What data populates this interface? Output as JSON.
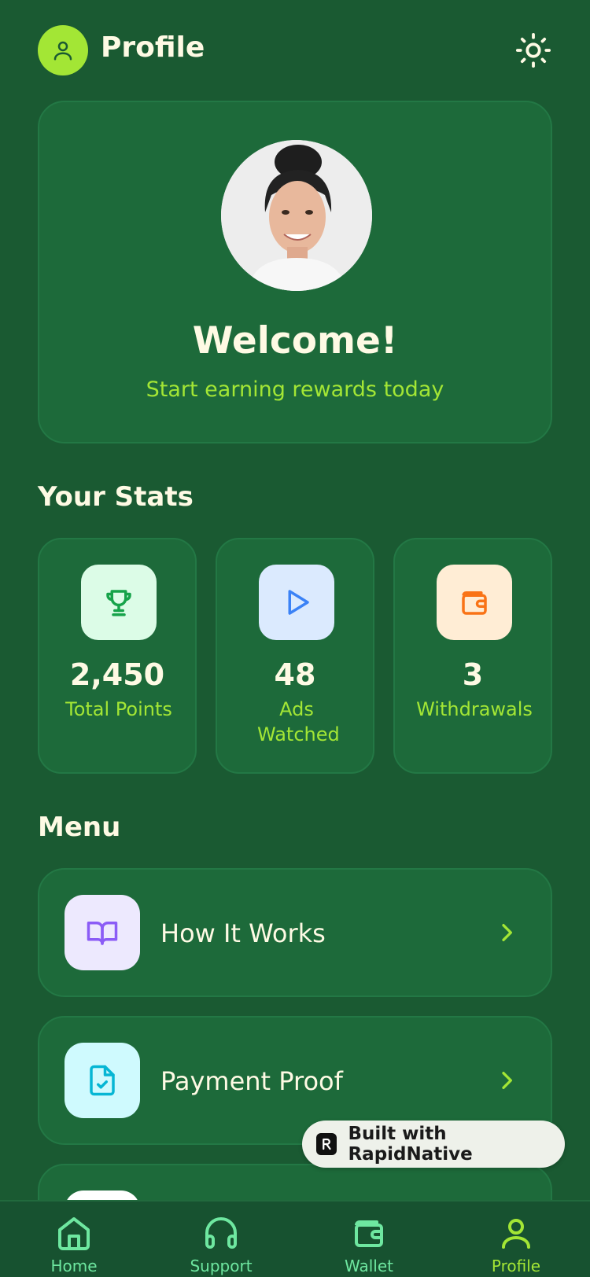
{
  "header": {
    "title": "Profile",
    "avatar_icon": "user-icon",
    "theme_icon": "sun-icon"
  },
  "profile": {
    "welcome": "Welcome!",
    "subtitle": "Start earning rewards today"
  },
  "stats": {
    "title": "Your Stats",
    "items": [
      {
        "icon": "trophy-icon",
        "value": "2,450",
        "label": "Total Points",
        "bg": "#dcfce7",
        "color": "#16a34a"
      },
      {
        "icon": "play-icon",
        "value": "48",
        "label": "Ads Watched",
        "bg": "#dbeafe",
        "color": "#3b82f6"
      },
      {
        "icon": "wallet-icon",
        "value": "3",
        "label": "Withdrawals",
        "bg": "#ffedd5",
        "color": "#f97316"
      }
    ]
  },
  "menu": {
    "title": "Menu",
    "items": [
      {
        "icon": "book-open-icon",
        "label": "How It Works",
        "bg": "#ede9fe",
        "color": "#8b5cf6"
      },
      {
        "icon": "file-check-icon",
        "label": "Payment Proof",
        "bg": "#cffafe",
        "color": "#06b6d4"
      },
      {
        "icon": "more-icon",
        "label": "",
        "bg": "#ffffff",
        "color": "#ffffff"
      }
    ]
  },
  "badge": {
    "text": "Built with RapidNative"
  },
  "nav": {
    "items": [
      {
        "icon": "home-icon",
        "label": "Home"
      },
      {
        "icon": "headphones-icon",
        "label": "Support"
      },
      {
        "icon": "wallet-icon",
        "label": "Wallet"
      },
      {
        "icon": "user-icon",
        "label": "Profile",
        "active": true
      }
    ]
  },
  "colors": {
    "background": "#1a5a32",
    "card": "#1d6a3a",
    "accent": "#a3e635",
    "text": "#fefae4"
  }
}
